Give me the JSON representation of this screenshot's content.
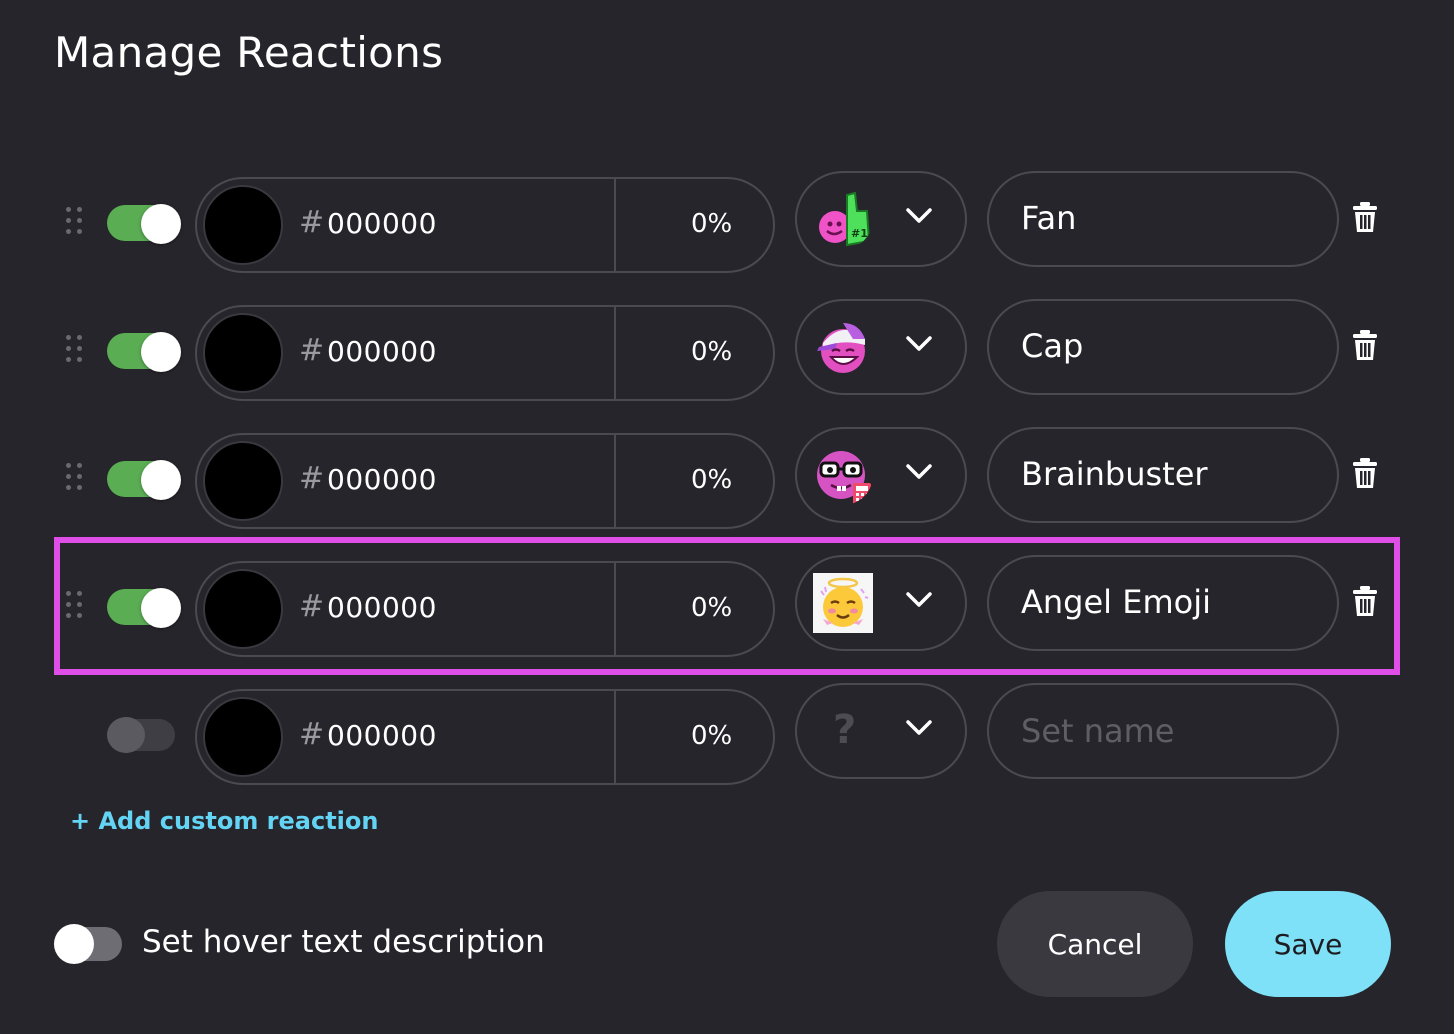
{
  "title": "Manage Reactions",
  "rows": [
    {
      "enabled": true,
      "hash": "#",
      "hex": "000000",
      "opacity": "0%",
      "emoji": "foam-finger-emoji",
      "name": "Fan"
    },
    {
      "enabled": true,
      "hash": "#",
      "hex": "000000",
      "opacity": "0%",
      "emoji": "cap-emoji",
      "name": "Cap"
    },
    {
      "enabled": true,
      "hash": "#",
      "hex": "000000",
      "opacity": "0%",
      "emoji": "nerd-calculator-emoji",
      "name": "Brainbuster"
    },
    {
      "enabled": true,
      "hash": "#",
      "hex": "000000",
      "opacity": "0%",
      "emoji": "angel-emoji",
      "name": "Angel Emoji"
    },
    {
      "enabled": false,
      "hash": "#",
      "hex": "000000",
      "opacity": "0%",
      "emoji": "question-mark",
      "emoji_placeholder": "?",
      "name": "",
      "name_placeholder": "Set name"
    }
  ],
  "add_custom_reaction": "+ Add custom reaction",
  "hover_text": {
    "label": "Set hover text description",
    "enabled": false
  },
  "buttons": {
    "cancel": "Cancel",
    "save": "Save"
  },
  "colors": {
    "background": "#26252b",
    "toggle_on": "#5aad53",
    "accent_link": "#63d4f3",
    "save_button": "#7fe1f7",
    "highlight": "#e04ee8",
    "swatch": "#000000"
  }
}
